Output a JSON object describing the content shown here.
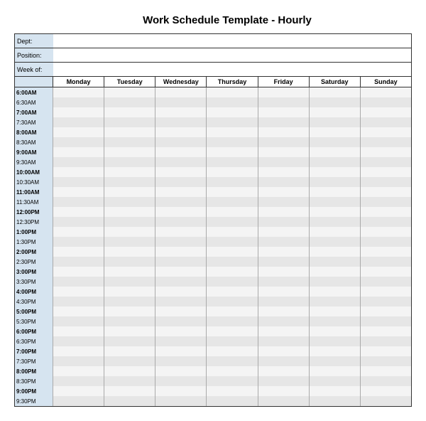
{
  "title": "Work Schedule Template - Hourly",
  "meta": {
    "dept_label": "Dept:",
    "position_label": "Position:",
    "week_of_label": "Week of:",
    "dept_value": "",
    "position_value": "",
    "week_of_value": ""
  },
  "days": [
    "Monday",
    "Tuesday",
    "Wednesday",
    "Thursday",
    "Friday",
    "Saturday",
    "Sunday"
  ],
  "timeslots": [
    {
      "label": "6:00AM",
      "bold": true
    },
    {
      "label": "6:30AM",
      "bold": false
    },
    {
      "label": "7:00AM",
      "bold": true
    },
    {
      "label": "7:30AM",
      "bold": false
    },
    {
      "label": "8:00AM",
      "bold": true
    },
    {
      "label": "8:30AM",
      "bold": false
    },
    {
      "label": "9:00AM",
      "bold": true
    },
    {
      "label": "9:30AM",
      "bold": false
    },
    {
      "label": "10:00AM",
      "bold": true
    },
    {
      "label": "10:30AM",
      "bold": false
    },
    {
      "label": "11:00AM",
      "bold": true
    },
    {
      "label": "11:30AM",
      "bold": false
    },
    {
      "label": "12:00PM",
      "bold": true
    },
    {
      "label": "12:30PM",
      "bold": false
    },
    {
      "label": "1:00PM",
      "bold": true
    },
    {
      "label": "1:30PM",
      "bold": false
    },
    {
      "label": "2:00PM",
      "bold": true
    },
    {
      "label": "2:30PM",
      "bold": false
    },
    {
      "label": "3:00PM",
      "bold": true
    },
    {
      "label": "3:30PM",
      "bold": false
    },
    {
      "label": "4:00PM",
      "bold": true
    },
    {
      "label": "4:30PM",
      "bold": false
    },
    {
      "label": "5:00PM",
      "bold": true
    },
    {
      "label": "5:30PM",
      "bold": false
    },
    {
      "label": "6:00PM",
      "bold": true
    },
    {
      "label": "6:30PM",
      "bold": false
    },
    {
      "label": "7:00PM",
      "bold": true
    },
    {
      "label": "7:30PM",
      "bold": false
    },
    {
      "label": "8:00PM",
      "bold": true
    },
    {
      "label": "8:30PM",
      "bold": false
    },
    {
      "label": "9:00PM",
      "bold": true
    },
    {
      "label": "9:30PM",
      "bold": false
    }
  ]
}
